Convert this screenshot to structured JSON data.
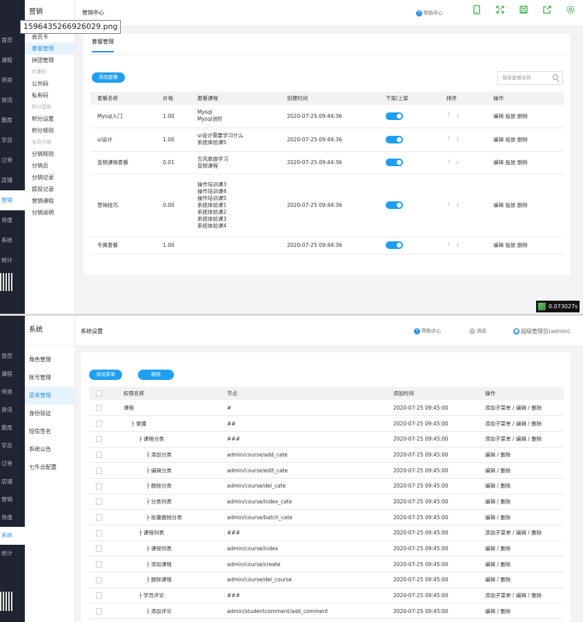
{
  "screen1": {
    "nav": [
      "首页",
      "课程",
      "师资",
      "资讯",
      "题库",
      "学员",
      "订单",
      "店铺",
      "营销",
      "充值",
      "系统",
      "统计"
    ],
    "nav_active": 8,
    "sub_title": "营销",
    "sub_items": [
      {
        "type": "link",
        "label": "会员卡"
      },
      {
        "type": "link",
        "label": "套餐管理",
        "active": true
      },
      {
        "type": "link",
        "label": "拼团管理"
      },
      {
        "type": "group",
        "label": "优惠码"
      },
      {
        "type": "link",
        "label": "公共码"
      },
      {
        "type": "link",
        "label": "私有码"
      },
      {
        "type": "group",
        "label": "积分营销"
      },
      {
        "type": "link",
        "label": "积分设置"
      },
      {
        "type": "link",
        "label": "积分规则"
      },
      {
        "type": "group",
        "label": "全员分销"
      },
      {
        "type": "link",
        "label": "分销规则"
      },
      {
        "type": "link",
        "label": "分销员"
      },
      {
        "type": "link",
        "label": "分销记录"
      },
      {
        "type": "link",
        "label": "提现记录"
      },
      {
        "type": "link",
        "label": "营销课程"
      },
      {
        "type": "link",
        "label": "分销说明"
      }
    ],
    "breadcrumb": "营销中心",
    "help": "帮助中心",
    "filename": "1596435266926029.png",
    "tab": "套餐管理",
    "add_button": "添加套餐",
    "search_placeholder": "搜索套餐名称",
    "columns": [
      "套餐名称",
      "价格",
      "套餐课程",
      "创建时间",
      "下架/上架",
      "排序",
      "操作"
    ],
    "rows": [
      {
        "name": "Mysql入门",
        "price": "1.00",
        "courses": [
          "Mysql",
          "Mysql进阶"
        ],
        "time": "2020-07-25 09:44:36",
        "ops": "编辑 投放 删除"
      },
      {
        "name": "ui设计",
        "price": "1.00",
        "courses": [
          "ui设计需要学习什么",
          "系统体验课5"
        ],
        "time": "2020-07-25 09:44:36",
        "ops": "编辑 投放 删除"
      },
      {
        "name": "音频课程套餐",
        "price": "0.01",
        "courses": [
          "古风歌曲学习",
          "音频课程"
        ],
        "time": "2020-07-25 09:44:36",
        "ops": "编辑 投放 删除"
      },
      {
        "name": "营销技巧",
        "price": "0.00",
        "courses": [
          "操作培训课3",
          "操作培训课4",
          "操作培训课5",
          "系统体验课1",
          "系统体验课2",
          "系统体验课3",
          "系统体验课4"
        ],
        "time": "2020-07-25 09:44:36",
        "ops": "编辑 投放 删除"
      },
      {
        "name": "专属套餐",
        "price": "1.00",
        "courses": [],
        "time": "2020-07-25 09:44:36",
        "ops": "编辑 投放 删除"
      }
    ],
    "timer": "0.073027s"
  },
  "screen2": {
    "nav": [
      "首页",
      "课程",
      "师资",
      "资讯",
      "题库",
      "学员",
      "订单",
      "店铺",
      "营销",
      "充值",
      "系统",
      "统计"
    ],
    "nav_active": 10,
    "sub_title": "系统",
    "sub_items": [
      {
        "type": "link",
        "label": "角色管理"
      },
      {
        "type": "link",
        "label": "账号管理"
      },
      {
        "type": "link",
        "label": "菜单管理",
        "active": true
      },
      {
        "type": "link",
        "label": "身份验证"
      },
      {
        "type": "link",
        "label": "短信签名"
      },
      {
        "type": "link",
        "label": "系统公告"
      },
      {
        "type": "link",
        "label": "七牛云配置"
      }
    ],
    "breadcrumb": "系统设置",
    "help": "帮助中心",
    "message": "消息",
    "user": "超级管理员(admin)",
    "add_button": "添加菜单",
    "delete_button": "删除",
    "columns": [
      "权限名称",
      "节点",
      "添加时间",
      "操作"
    ],
    "rows": [
      {
        "name": "课程",
        "indent": 0,
        "node": "#",
        "time": "2020-07-25 09:45:00",
        "ops": "添加子菜单 / 编辑 / 删除"
      },
      {
        "name": "├ 录播",
        "indent": 1,
        "node": "##",
        "time": "2020-07-25 09:45:00",
        "ops": "添加子菜单 / 编辑 / 删除"
      },
      {
        "name": "├ 课程分类",
        "indent": 2,
        "node": "###",
        "time": "2020-07-25 09:45:00",
        "ops": "添加子菜单 / 编辑 / 删除"
      },
      {
        "name": "├ 添加分类",
        "indent": 3,
        "node": "admin/course/add_cate",
        "time": "2020-07-25 09:45:00",
        "ops": "编辑 / 删除"
      },
      {
        "name": "├ 编辑分类",
        "indent": 3,
        "node": "admin/course/edit_cate",
        "time": "2020-07-25 09:45:00",
        "ops": "编辑 / 删除"
      },
      {
        "name": "├ 删除分类",
        "indent": 3,
        "node": "admin/course/del_cate",
        "time": "2020-07-25 09:45:00",
        "ops": "编辑 / 删除"
      },
      {
        "name": "├ 分类列表",
        "indent": 3,
        "node": "admin/course/index_cate",
        "time": "2020-07-25 09:45:00",
        "ops": "编辑 / 删除"
      },
      {
        "name": "├ 批量删除分类",
        "indent": 3,
        "node": "admin/course/batch_cate",
        "time": "2020-07-25 09:45:00",
        "ops": "编辑 / 删除"
      },
      {
        "name": "├ 课程列表",
        "indent": 2,
        "node": "###",
        "time": "2020-07-25 09:45:00",
        "ops": "添加子菜单 / 编辑 / 删除"
      },
      {
        "name": "├ 课程列表",
        "indent": 3,
        "node": "admin/course/index",
        "time": "2020-07-25 09:45:00",
        "ops": "编辑 / 删除"
      },
      {
        "name": "├ 添加课程",
        "indent": 3,
        "node": "admin/course/create",
        "time": "2020-07-25 09:45:00",
        "ops": "编辑 / 删除"
      },
      {
        "name": "├ 删除课程",
        "indent": 3,
        "node": "admin/course/del_course",
        "time": "2020-07-25 09:45:00",
        "ops": "编辑 / 删除"
      },
      {
        "name": "├ 学员评论",
        "indent": 2,
        "node": "###",
        "time": "2020-07-25 09:45:00",
        "ops": "添加子菜单 / 编辑 / 删除"
      },
      {
        "name": "├ 添加评论",
        "indent": 3,
        "node": "admin/studentcomment/add_comment",
        "time": "2020-07-25 09:45:00",
        "ops": "编辑 / 删除"
      }
    ]
  }
}
